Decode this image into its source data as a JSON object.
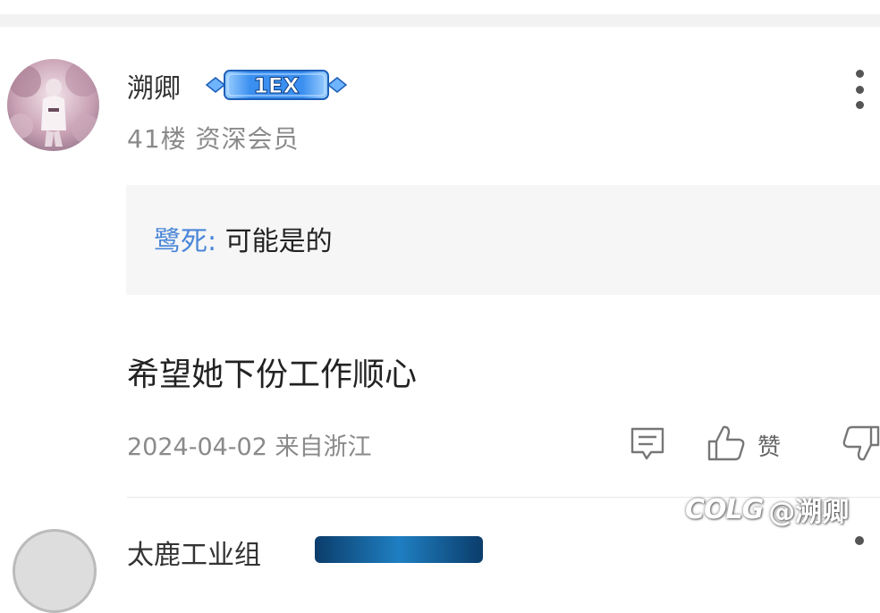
{
  "post": {
    "username": "溯卿",
    "badge_text": "1EX",
    "floor_meta": "41楼 资深会员",
    "quote": {
      "author": "鹭死:",
      "text": " 可能是的"
    },
    "content": "希望她下份工作顺心",
    "date_location": "2024-04-02 来自浙江",
    "actions": {
      "comment_icon": "comment-icon",
      "like_icon": "thumbs-up-icon",
      "like_label": "赞",
      "dislike_icon": "thumbs-down-icon",
      "more_icon": "more-vertical-icon"
    }
  },
  "next_post": {
    "username": "太鹿工业组"
  },
  "watermark": {
    "logo": "COLG",
    "handle": "@溯卿"
  },
  "colors": {
    "accent_blue": "#4a86d8",
    "meta_gray": "#8a8a8a",
    "quote_bg": "#f6f6f6",
    "badge_blue": "#3a8ff0"
  }
}
